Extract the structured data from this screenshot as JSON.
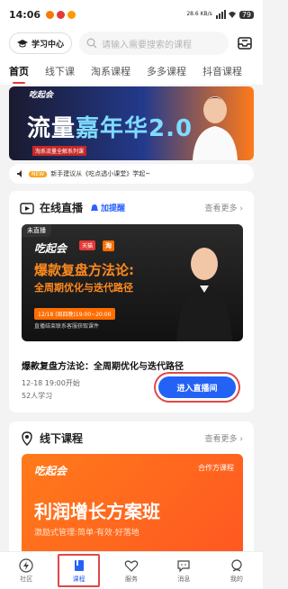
{
  "statusbar": {
    "time": "14:06",
    "net": "28.6\nKB/s",
    "battery": "79"
  },
  "topbar": {
    "study_label": "学习中心",
    "search_placeholder": "请输入需要搜索的课程"
  },
  "tabs": [
    "首页",
    "线下课",
    "淘系课程",
    "多多课程",
    "抖音课程"
  ],
  "banner": {
    "logo": "吃起会",
    "title_a": "流量",
    "title_b": "嘉年华2.0",
    "subtitle": "淘系流量全解系列课"
  },
  "notice": {
    "badge": "NEW",
    "text": "新手建议从《吃点透小课堂》学起~"
  },
  "live": {
    "section_title": "在线直播",
    "remind": "加提醒",
    "more": "查看更多",
    "tag": "未直播",
    "brand": "吃起会",
    "partner1": "天猫",
    "partner2": "淘",
    "image_title1": "爆款复盘方法论:",
    "image_title2": "全周期优化与迭代路径",
    "image_date": "12/18 (周四晚)19:00~20:00",
    "image_hint": "直播结束联系客服获取课件",
    "course_title": "爆款复盘方法论：全周期优化与迭代路径",
    "time": "12-18 19:00开始",
    "count": "52人学习",
    "enter_button": "进入直播间"
  },
  "offline": {
    "section_title": "线下课程",
    "more": "查看更多",
    "brand": "吃起会",
    "partner": "合作方课程",
    "image_title": "利润增长方案班",
    "image_sub": "激励式管理:简单·有效·好落地"
  },
  "bottomnav": [
    {
      "label": "社区",
      "icon": "lightning-icon"
    },
    {
      "label": "课程",
      "icon": "book-icon"
    },
    {
      "label": "服务",
      "icon": "heart-icon"
    },
    {
      "label": "消息",
      "icon": "chat-icon"
    },
    {
      "label": "我的",
      "icon": "user-icon"
    }
  ],
  "colors": {
    "accent": "#2362f5",
    "highlight": "#e04848",
    "orange": "#ff7a1a"
  }
}
